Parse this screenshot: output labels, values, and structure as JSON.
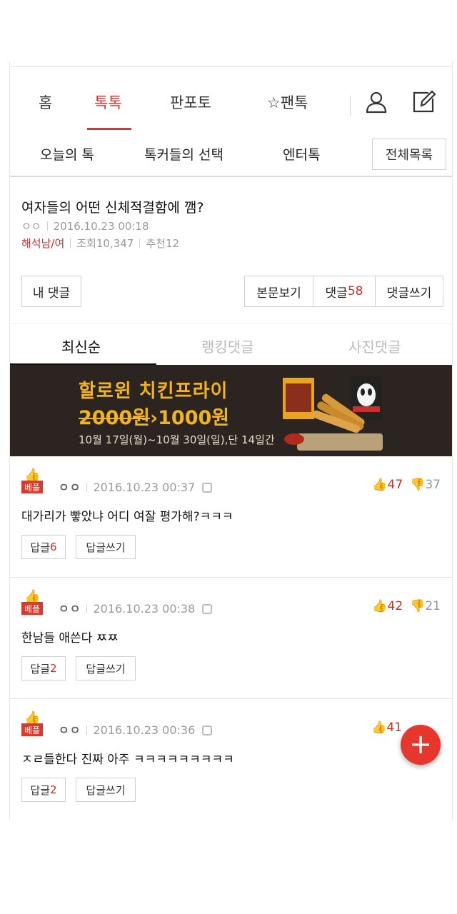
{
  "nav": {
    "tabs": [
      "홈",
      "톡톡",
      "판포토",
      "팬톡"
    ],
    "active_index": 1
  },
  "sub_nav": {
    "items": [
      "오늘의 톡",
      "톡커들의 선택",
      "엔터톡"
    ],
    "all_list": "전체목록"
  },
  "article": {
    "title": "여자들의 어떤 신체적결함에 깸?",
    "author": "ㅇㅇ",
    "date": "2016.10.23 00:18",
    "tag": "해석남/여",
    "views": "조회10,347",
    "recommend": "추천12"
  },
  "actions": {
    "my_comment": "내 댓글",
    "view_body": "본문보기",
    "comments_label": "댓글",
    "comments_count": "58",
    "write_comment": "댓글쓰기"
  },
  "sort_tabs": [
    "최신순",
    "랭킹댓글",
    "사진댓글"
  ],
  "banner": {
    "title": "할로윈 치킨프라이",
    "old_price": "2000원",
    "new_price": "1000원",
    "date": "10월 17일(월)~10월 30일(일),단 14일간"
  },
  "comments": [
    {
      "badge": "베플",
      "user": "ㅇㅇ",
      "date": "2016.10.23 00:37",
      "up": "47",
      "down": "37",
      "text": "대가리가 빻았냐 어디 여잘 평가해?ㅋㅋㅋ",
      "reply_label": "답글",
      "reply_count": "6",
      "write_reply": "답글쓰기"
    },
    {
      "badge": "베플",
      "user": "ㅇㅇ",
      "date": "2016.10.23 00:38",
      "up": "42",
      "down": "21",
      "text": "한남들 애쓴다 ㅉㅉ",
      "reply_label": "답글",
      "reply_count": "2",
      "write_reply": "답글쓰기"
    },
    {
      "badge": "베플",
      "user": "ㅇㅇ",
      "date": "2016.10.23 00:36",
      "up": "41",
      "down": "",
      "text": "ㅈㄹ들한다 진짜 아주 ㅋㅋㅋㅋㅋㅋㅋㅋㅋ",
      "reply_label": "답글",
      "reply_count": "2",
      "write_reply": "답글쓰기"
    }
  ],
  "colors": {
    "accent": "#e0312a",
    "banner_bg": "#2b2421",
    "banner_text": "#f2b41e"
  }
}
